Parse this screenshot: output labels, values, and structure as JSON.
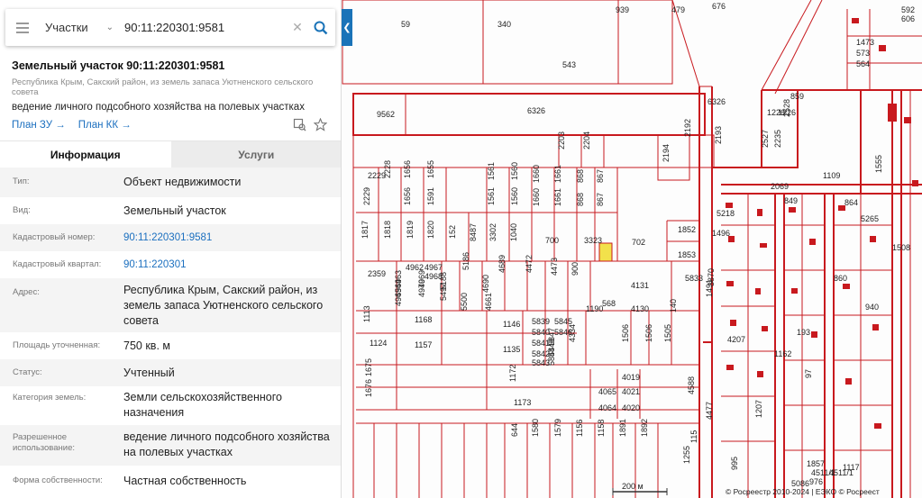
{
  "search": {
    "type_label": "Участки",
    "query": "90:11:220301:9581"
  },
  "object": {
    "title": "Земельный участок 90:11:220301:9581",
    "address_short": "Республика Крым, Сакский район, из земель запаса Уютненского сельского совета",
    "usage": "ведение личного подсобного хозяйства на полевых участках",
    "plan_zu": "План ЗУ →",
    "plan_kk": "План КК →"
  },
  "tabs": [
    {
      "label": "Информация",
      "active": true
    },
    {
      "label": "Услуги",
      "active": false
    }
  ],
  "info_rows": [
    {
      "label": "Тип:",
      "value": "Объект недвижимости"
    },
    {
      "label": "Вид:",
      "value": "Земельный участок"
    },
    {
      "label": "Кадастровый номер:",
      "value": "90:11:220301:9581"
    },
    {
      "label": "Кадастровый квартал:",
      "value": "90:11:220301"
    },
    {
      "label": "Адрес:",
      "value": "Республика Крым, Сакский район, из земель запаса Уютненского сельского совета"
    },
    {
      "label": "Площадь уточненная:",
      "value": "750 кв. м"
    },
    {
      "label": "Статус:",
      "value": "Учтенный"
    },
    {
      "label": "Категория земель:",
      "value": "Земли сельскохозяйственного назначения"
    },
    {
      "label": "Разрешенное использование:",
      "value": "ведение личного подсобного хозяйства на полевых участках"
    },
    {
      "label": "Форма собственности:",
      "value": "Частная собственность"
    }
  ],
  "map": {
    "parcel_labels": [
      "59",
      "340",
      "939",
      "479",
      "676",
      "592",
      "606",
      "1473",
      "573",
      "564",
      "543",
      "859",
      "6326",
      "9562",
      "6326",
      "1226",
      "1226",
      "2528",
      "2194",
      "2192",
      "2193",
      "2527",
      "2235",
      "2203",
      "2204",
      "2229",
      "2228",
      "1656",
      "1655",
      "2229",
      "1656",
      "1591",
      "1561",
      "1560",
      "1660",
      "1661",
      "868",
      "867",
      "1561",
      "1560",
      "1660",
      "1661",
      "868",
      "867",
      "1817",
      "1818",
      "1819",
      "1820",
      "152",
      "8487",
      "3302",
      "1040",
      "700",
      "3323",
      "702",
      "1852",
      "1853",
      "2359",
      "4962",
      "4967",
      "4968",
      "4969",
      "4970",
      "4965",
      "4964",
      "4963",
      "5186",
      "5188",
      "5497",
      "5500",
      "4689",
      "4690",
      "4661",
      "4472",
      "4473",
      "900",
      "4131",
      "4130",
      "1190",
      "568",
      "5833",
      "140",
      "1113",
      "1168",
      "1146",
      "1124",
      "1157",
      "1135",
      "5839",
      "5840",
      "5841",
      "5842",
      "5843",
      "5845",
      "5846",
      "5847",
      "5848",
      "5844",
      "4334",
      "1506",
      "1506",
      "1505",
      "3870",
      "1491",
      "1675",
      "1172",
      "1676",
      "1173",
      "4019",
      "4021",
      "4020",
      "4065",
      "4064",
      "4588",
      "4477",
      "1207",
      "644",
      "1580",
      "1579",
      "1156",
      "1158",
      "1891",
      "1892",
      "1255",
      "115",
      "995",
      "1857",
      "1117",
      "5086",
      "976",
      "2069",
      "1109",
      "849",
      "864",
      "5265",
      "5218",
      "1496",
      "860",
      "940",
      "193",
      "4207",
      "1162",
      "97",
      "1555",
      "1508",
      "4511/1",
      "4511/1"
    ],
    "scale_label": "200 м",
    "copyright": "© Росреестр 2010-2024 | ЕЭКО © Росреест"
  },
  "colors": {
    "accent": "#1a73b8",
    "link": "#1b6fbf",
    "parcel_border": "#c8191e",
    "selected_parcel": "#f2e14b"
  },
  "icons": [
    "menu-icon",
    "chevron-down-icon",
    "close-icon",
    "search-icon",
    "chevron-left-icon",
    "copy-link-icon",
    "star-icon",
    "arrow-right-icon"
  ]
}
